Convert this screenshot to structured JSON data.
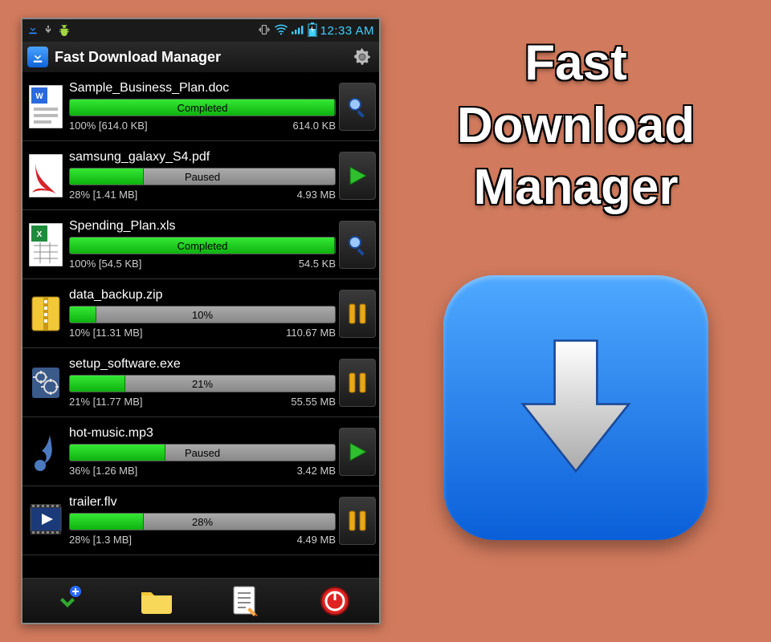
{
  "statusbar": {
    "time": "12:33 AM"
  },
  "appbar": {
    "title": "Fast Download Manager"
  },
  "downloads": [
    {
      "icon": "doc",
      "name": "Sample_Business_Plan.doc",
      "progress": 100,
      "label": "Completed",
      "detail_left": "100% [614.0 KB]",
      "detail_right": "614.0 KB",
      "action": "search"
    },
    {
      "icon": "pdf",
      "name": "samsung_galaxy_S4.pdf",
      "progress": 28,
      "label": "Paused",
      "detail_left": "28% [1.41 MB]",
      "detail_right": "4.93 MB",
      "action": "play"
    },
    {
      "icon": "xls",
      "name": "Spending_Plan.xls",
      "progress": 100,
      "label": "Completed",
      "detail_left": "100% [54.5 KB]",
      "detail_right": "54.5 KB",
      "action": "search"
    },
    {
      "icon": "zip",
      "name": "data_backup.zip",
      "progress": 10,
      "label": "10%",
      "detail_left": "10% [11.31 MB]",
      "detail_right": "110.67 MB",
      "action": "pause"
    },
    {
      "icon": "exe",
      "name": "setup_software.exe",
      "progress": 21,
      "label": "21%",
      "detail_left": "21% [11.77 MB]",
      "detail_right": "55.55 MB",
      "action": "pause"
    },
    {
      "icon": "mp3",
      "name": "hot-music.mp3",
      "progress": 36,
      "label": "Paused",
      "detail_left": "36% [1.26 MB]",
      "detail_right": "3.42 MB",
      "action": "play"
    },
    {
      "icon": "video",
      "name": "trailer.flv",
      "progress": 28,
      "label": "28%",
      "detail_left": "28% [1.3 MB]",
      "detail_right": "4.49 MB",
      "action": "pause"
    }
  ],
  "promo": {
    "line1": "Fast",
    "line2": "Download",
    "line3": "Manager"
  }
}
